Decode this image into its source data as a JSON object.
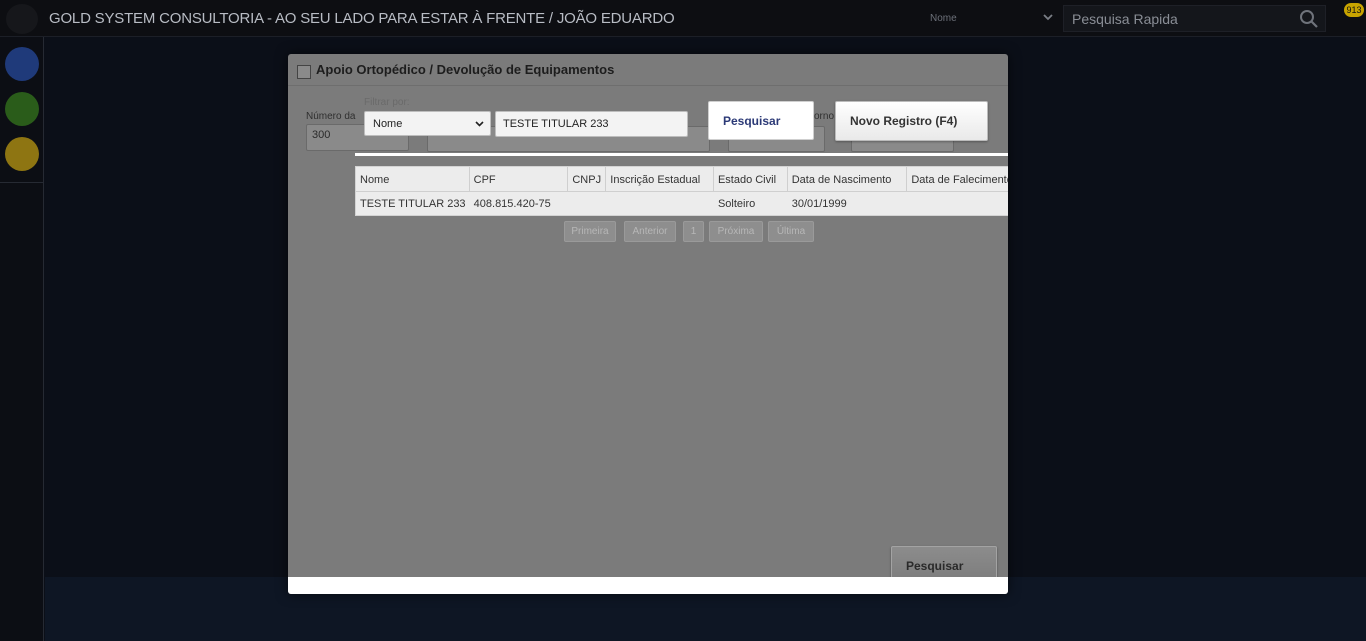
{
  "topbar": {
    "title": "GOLD SYSTEM CONSULTORIA - AO SEU LADO PARA ESTAR À FRENTE / JOÃO EDUARDO",
    "filter_value": "Nome",
    "search_placeholder": "Pesquisa Rapida",
    "badge": "913"
  },
  "modal": {
    "title": "Apoio Ortopédico / Devolução de Equipamentos",
    "bg_labels": {
      "numero": "Número da",
      "numero_value": "300",
      "retorno": "orno"
    },
    "filter": {
      "label": "Filtrar por:",
      "selected": "Nome",
      "search_value": "TESTE TITULAR 233"
    },
    "buttons": {
      "pesquisar": "Pesquisar",
      "novo_registro": "Novo Registro (F4)",
      "pesquisar_bottom": "Pesquisar"
    },
    "table": {
      "columns": [
        "Nome",
        "CPF",
        "CNPJ",
        "Inscrição Estadual",
        "Estado Civil",
        "Data de Nascimento",
        "Data de Falecimento"
      ],
      "rows": [
        [
          "TESTE TITULAR 233",
          "408.815.420-75",
          "",
          "",
          "Solteiro",
          "30/01/1999",
          ""
        ]
      ]
    },
    "pager": {
      "first": "Primeira",
      "prev": "Anterior",
      "page": "1",
      "next": "Próxima",
      "last": "Última"
    }
  },
  "colors": {
    "topbar_bg": "#0d0e12",
    "modal_bg": "#7b7b7b",
    "accent_blue": "#2c3a77",
    "badge": "#c8a400"
  }
}
